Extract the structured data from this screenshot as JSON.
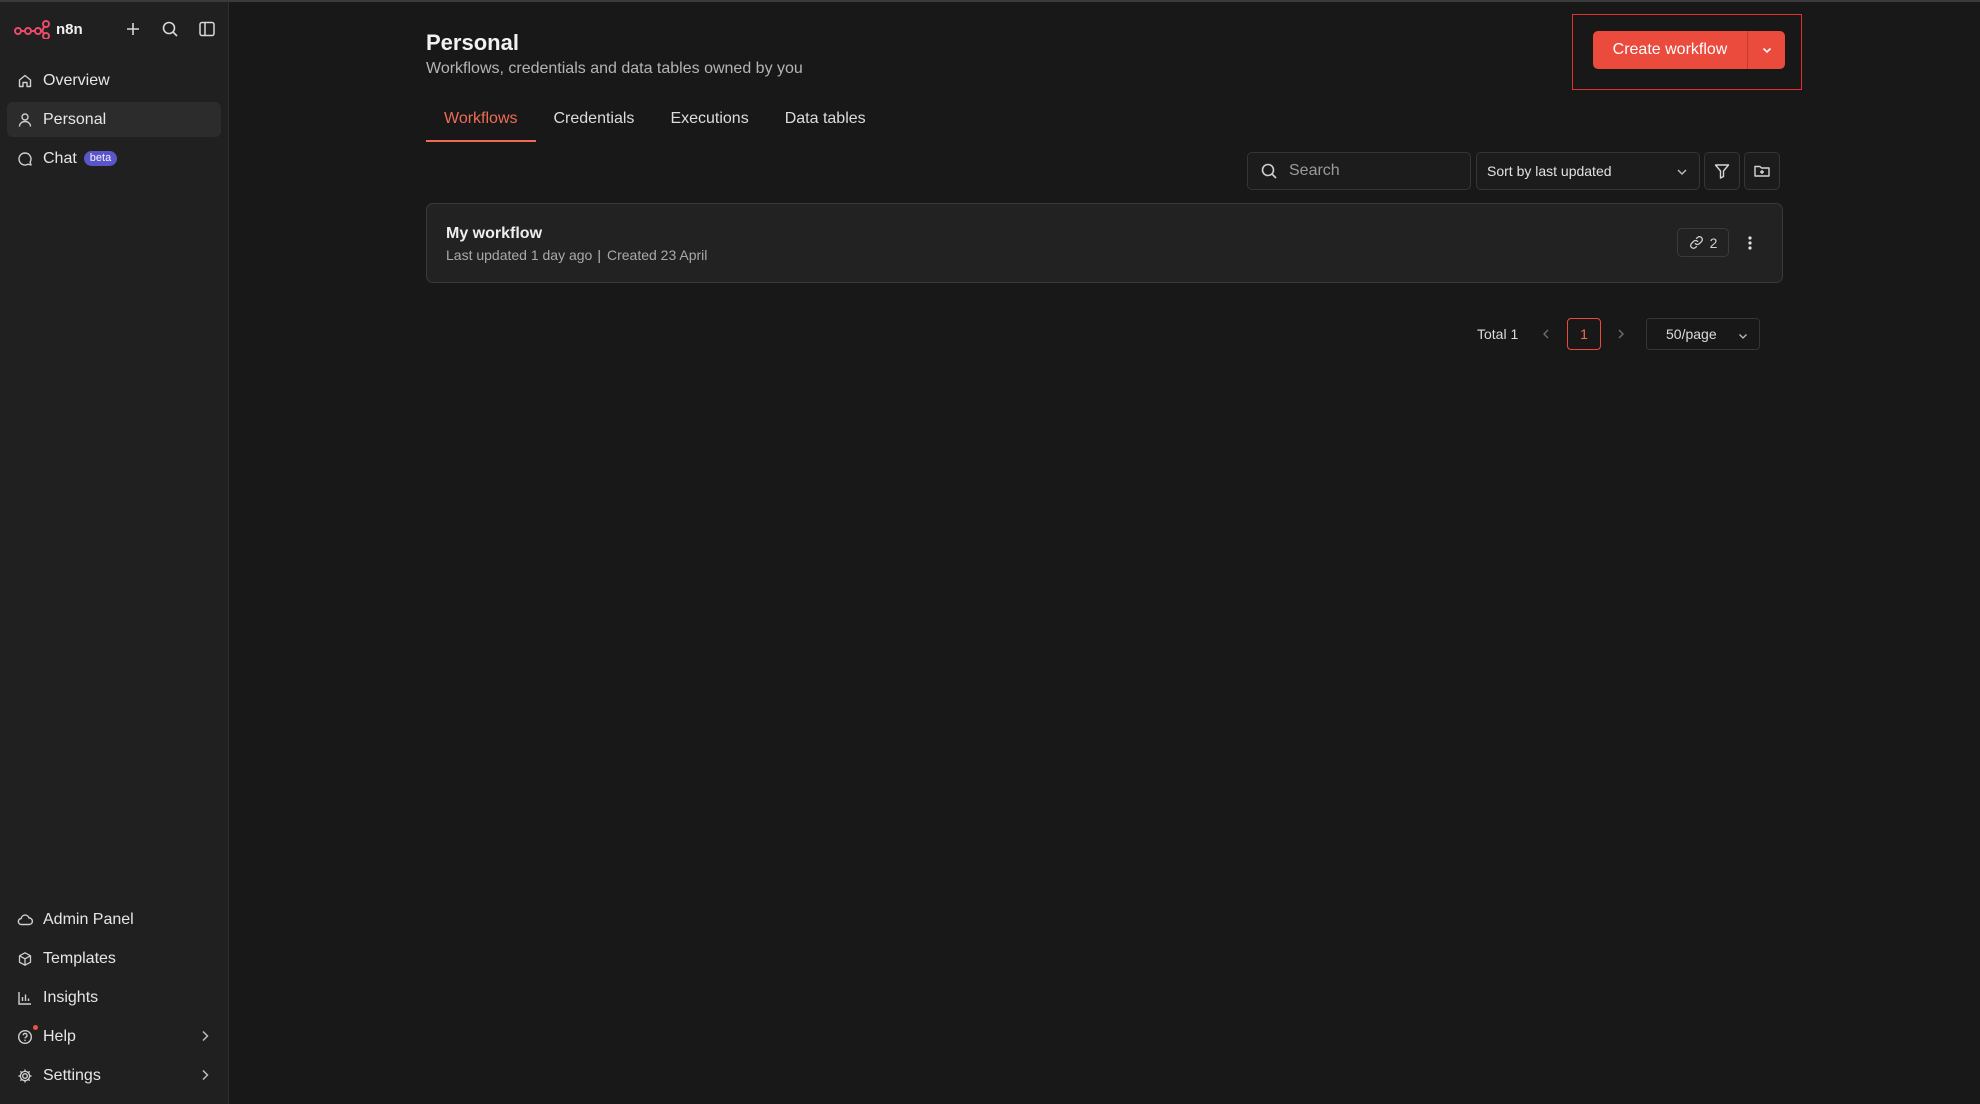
{
  "sidebar": {
    "brand": "n8n",
    "top_items": [
      {
        "label": "Overview",
        "icon": "home-icon"
      },
      {
        "label": "Personal",
        "icon": "user-icon"
      },
      {
        "label": "Chat",
        "icon": "chat-icon",
        "badge": "beta"
      }
    ],
    "bottom_items": [
      {
        "label": "Admin Panel",
        "icon": "cloud-icon"
      },
      {
        "label": "Templates",
        "icon": "box-icon"
      },
      {
        "label": "Insights",
        "icon": "bar-chart-icon"
      },
      {
        "label": "Help",
        "icon": "help-circle-icon"
      },
      {
        "label": "Settings",
        "icon": "gear-icon"
      }
    ]
  },
  "header": {
    "title": "Personal",
    "subtitle": "Workflows, credentials and data tables owned by you",
    "create_label": "Create workflow"
  },
  "tabs": [
    {
      "label": "Workflows",
      "active": true
    },
    {
      "label": "Credentials",
      "active": false
    },
    {
      "label": "Executions",
      "active": false
    },
    {
      "label": "Data tables",
      "active": false
    }
  ],
  "toolbar": {
    "search_placeholder": "Search",
    "sort_label": "Sort by last updated"
  },
  "workflows": [
    {
      "name": "My workflow",
      "updated": "Last updated 1 day ago",
      "created": "Created 23 April",
      "link_count": "2"
    }
  ],
  "pagination": {
    "total": "Total 1",
    "current_page": "1",
    "per_page": "50/page"
  },
  "colors": {
    "accent": "#ea4b3c",
    "background": "#181818",
    "sidebar": "#202020",
    "beta_badge": "#5a55c8"
  }
}
